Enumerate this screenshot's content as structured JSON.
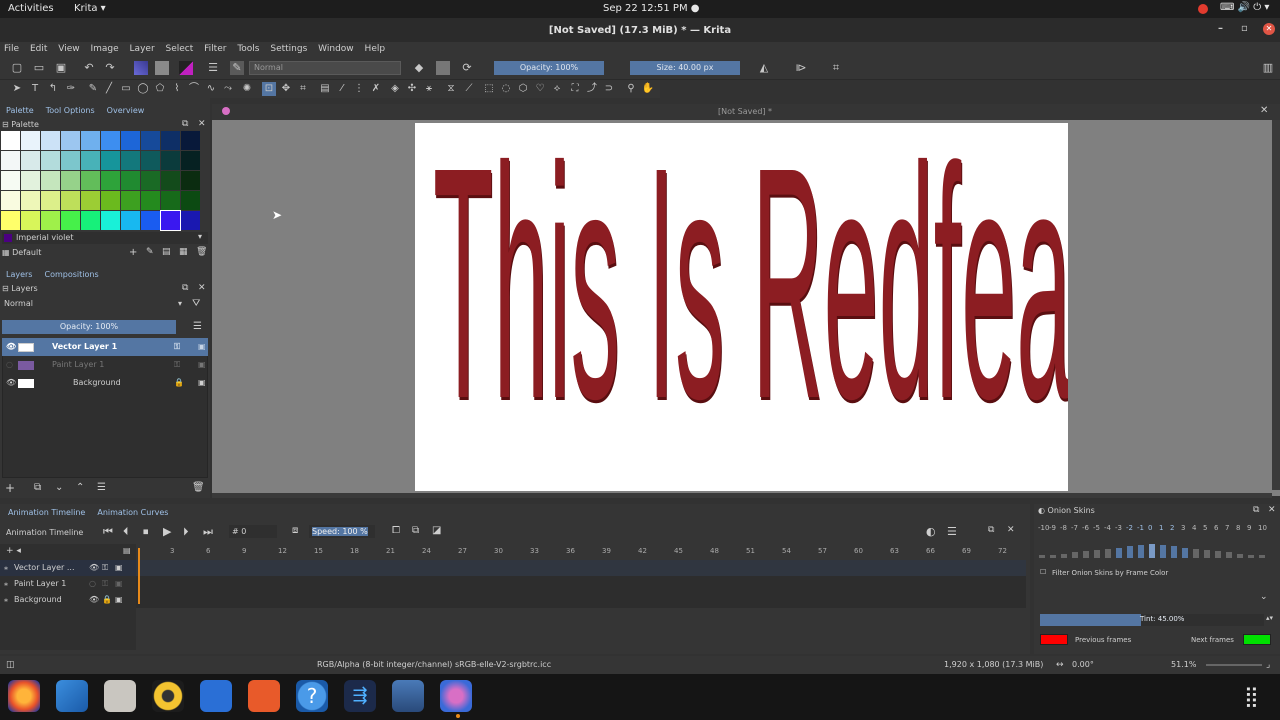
{
  "topbar": {
    "activities": "Activities",
    "app_menu": "Krita ▾",
    "clock": "Sep 22  12:51 PM  ●"
  },
  "window": {
    "title": "[Not Saved]  (17.3 MiB)  * — Krita",
    "minimize": "–",
    "restore": "▫",
    "close": "✕"
  },
  "menu": [
    "File",
    "Edit",
    "View",
    "Image",
    "Layer",
    "Select",
    "Filter",
    "Tools",
    "Settings",
    "Window",
    "Help"
  ],
  "toolbar": {
    "blend_mode": "Normal",
    "opacity": "Opacity: 100%",
    "size": "Size: 40.00 px"
  },
  "left_tabs": [
    "Palette",
    "Tool Options",
    "Overview"
  ],
  "palette": {
    "header": "Palette",
    "color_name": "Imperial violet",
    "palette_name": "Default",
    "colors": [
      "#ffffff",
      "#e9f3fb",
      "#cce2f7",
      "#9cc6f0",
      "#6fb0ee",
      "#3d8ef0",
      "#1d66d8",
      "#164a9a",
      "#0e2f66",
      "#08193a",
      "#f3f7f7",
      "#d8eaea",
      "#b3dcdc",
      "#7cc6cc",
      "#48b2b8",
      "#16959b",
      "#13787c",
      "#0f5a5c",
      "#0b3b3c",
      "#062122",
      "#f6fbf3",
      "#e2f2dd",
      "#c5e6bd",
      "#96d28a",
      "#62bd5a",
      "#2ea33a",
      "#208a30",
      "#1a6a25",
      "#134b1b",
      "#0b2c10",
      "#f9fbe0",
      "#eef7b8",
      "#dcef8a",
      "#bedf5a",
      "#9ccd34",
      "#6bba1e",
      "#3da020",
      "#248a1e",
      "#176a1a",
      "#0c4a12",
      "#ffff6a",
      "#d8f55a",
      "#9ff04a",
      "#46f04a",
      "#17f07a",
      "#19f0d8",
      "#18b8f0",
      "#1a5cf0",
      "#3a18f0",
      "#1a18b0"
    ]
  },
  "layers_tabs": [
    "Layers",
    "Compositions"
  ],
  "layers": {
    "header": "Layers",
    "blend_mode": "Normal",
    "opacity": "Opacity:  100%",
    "items": [
      {
        "name": "Vector Layer 1"
      },
      {
        "name": "Paint Layer 1"
      },
      {
        "name": "Background"
      }
    ]
  },
  "canvas": {
    "doc_title": "[Not Saved]  *",
    "text": "This Is Redfeather"
  },
  "anim": {
    "tabs": [
      "Animation Timeline",
      "Animation Curves"
    ],
    "label": "Animation Timeline",
    "frame": "# 0",
    "speed": "Speed: 100 %",
    "ticks": [
      "3",
      "6",
      "9",
      "12",
      "15",
      "18",
      "21",
      "24",
      "27",
      "30",
      "33",
      "36",
      "39",
      "42",
      "45",
      "48",
      "51",
      "54",
      "57",
      "60",
      "63",
      "66",
      "69",
      "72"
    ],
    "layers": [
      "Vector Layer ...",
      "Paint Layer 1",
      "Background"
    ]
  },
  "onion": {
    "header": "Onion Skins",
    "scale": [
      "-10",
      "-9",
      "-8",
      "-7",
      "-6",
      "-5",
      "-4",
      "-3",
      "-2",
      "-1",
      "0",
      "1",
      "2",
      "3",
      "4",
      "5",
      "6",
      "7",
      "8",
      "9",
      "10"
    ],
    "filter_label": "Filter Onion Skins by Frame Color",
    "tint": "Tint: 45.00%",
    "tint_value": 0.45,
    "previous": "Previous frames",
    "next": "Next frames",
    "previous_color": "#ff0000",
    "next_color": "#00e000"
  },
  "status": {
    "colorspace": "RGB/Alpha (8-bit integer/channel)  sRGB-elle-V2-srgbtrc.icc",
    "size": "1,920 x 1,080 (17.3 MiB)",
    "rotation": "0.00°",
    "zoom": "51.1%"
  }
}
